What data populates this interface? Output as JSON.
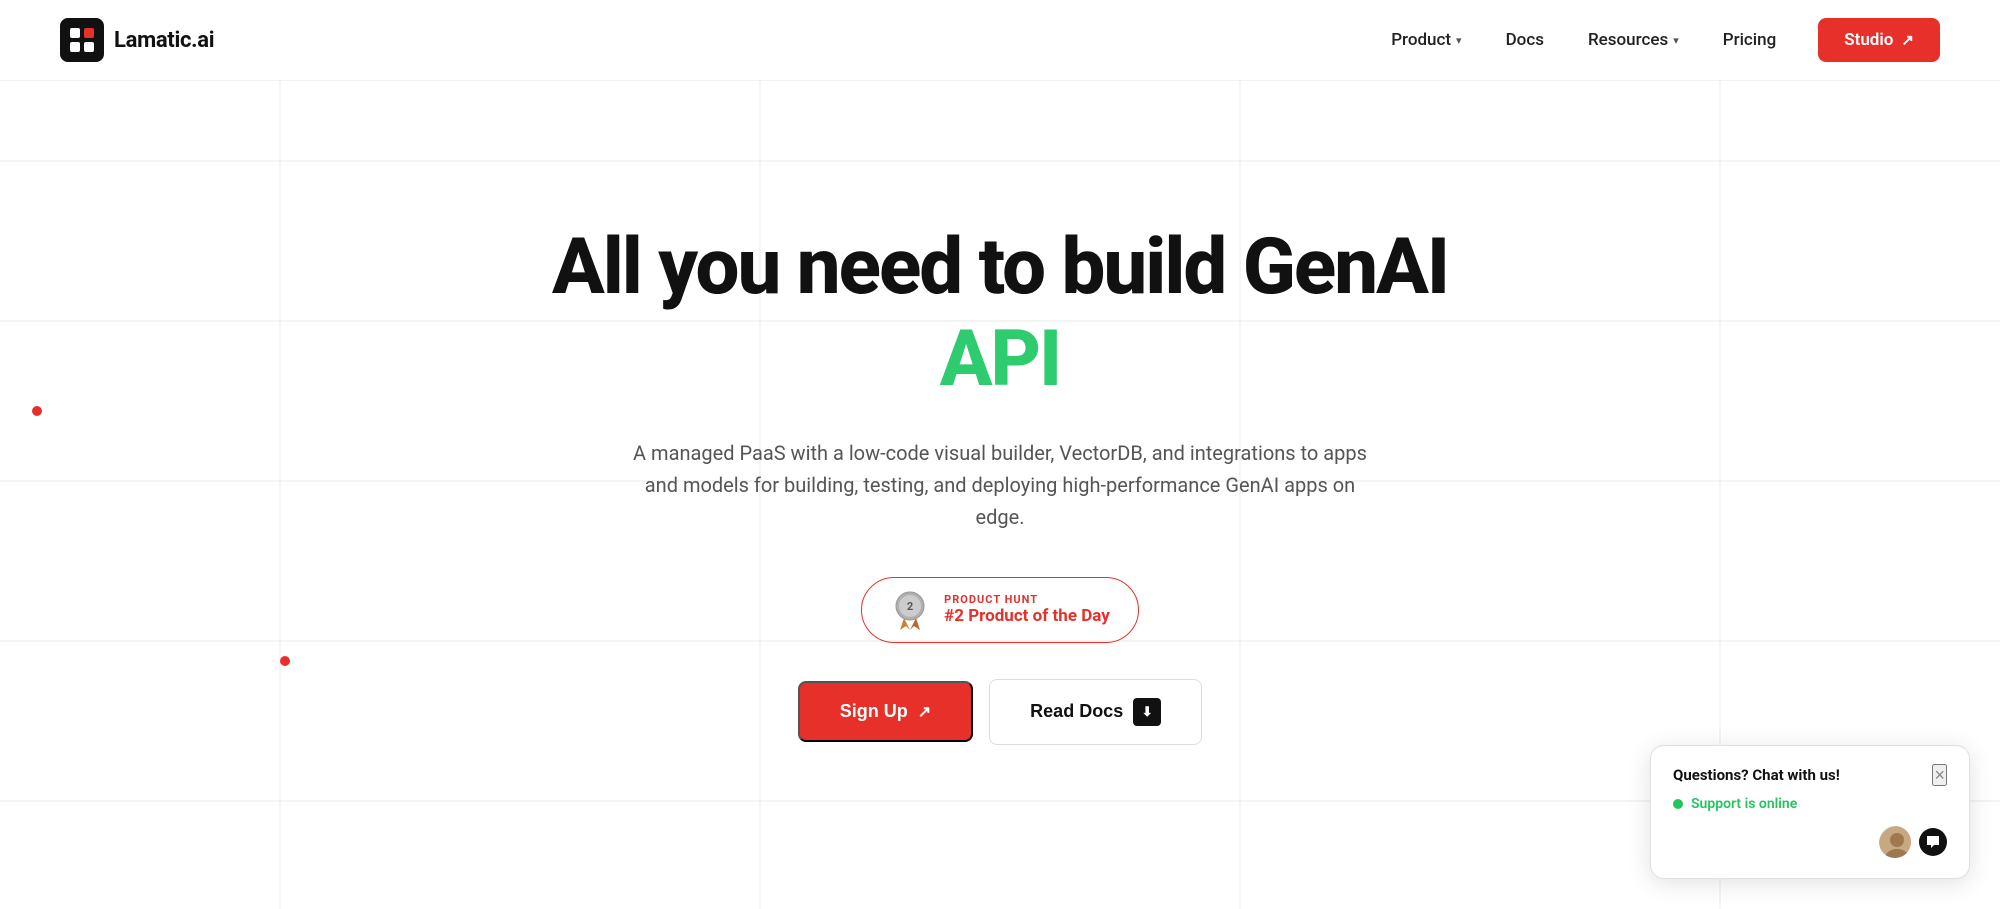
{
  "brand": {
    "name": "Lamatic.ai"
  },
  "navbar": {
    "product_label": "Product",
    "docs_label": "Docs",
    "resources_label": "Resources",
    "pricing_label": "Pricing",
    "studio_label": "Studio",
    "studio_arrow": "↗"
  },
  "hero": {
    "title_line1": "All you need to build GenAI",
    "title_line2": "API",
    "subtitle": "A managed PaaS with a low-code visual builder, VectorDB, and integrations to apps and models for building, testing, and deploying high-performance GenAI apps on edge.",
    "ph_label": "PRODUCT HUNT",
    "ph_rank": "#2 Product of the Day",
    "ph_number": "2",
    "signup_label": "Sign Up",
    "signup_arrow": "↗",
    "docs_label": "Read Docs",
    "docs_icon": "⬇"
  },
  "chat_widget": {
    "title": "Questions? Chat with us!",
    "status": "Support is online",
    "close_label": "×"
  },
  "colors": {
    "accent_red": "#e8302a",
    "accent_green": "#2ecc6e",
    "dot_red": "#e8302a",
    "online_green": "#22c55e"
  }
}
